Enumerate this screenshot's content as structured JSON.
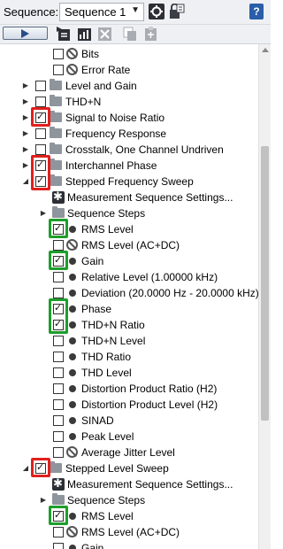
{
  "header": {
    "sequence_label": "Sequence:",
    "sequence_value": "Sequence 1"
  },
  "tree": [
    {
      "label": "Bits",
      "checked": false,
      "icon": "no-sign-icon"
    },
    {
      "label": "Error Rate",
      "checked": false,
      "icon": "no-sign-icon"
    },
    {
      "label": "Level and Gain",
      "checked": false,
      "icon": "folder-icon",
      "expanded": false
    },
    {
      "label": "THD+N",
      "checked": false,
      "icon": "folder-icon",
      "expanded": false
    },
    {
      "label": "Signal to Noise Ratio",
      "checked": true,
      "icon": "folder-icon",
      "expanded": false
    },
    {
      "label": "Frequency Response",
      "checked": false,
      "icon": "folder-icon",
      "expanded": false
    },
    {
      "label": "Crosstalk, One Channel Undriven",
      "checked": false,
      "icon": "folder-icon",
      "expanded": false
    },
    {
      "label": "Interchannel Phase",
      "checked": true,
      "icon": "folder-icon",
      "expanded": false
    },
    {
      "label": "Stepped Frequency Sweep",
      "checked": true,
      "icon": "folder-icon",
      "expanded": true
    },
    {
      "label": "Measurement Sequence Settings...",
      "icon": "gear-icon"
    },
    {
      "label": "Sequence Steps",
      "icon": "folder-icon",
      "expanded": false
    },
    {
      "label": "RMS Level",
      "checked": true,
      "icon": "dot-icon"
    },
    {
      "label": "RMS Level (AC+DC)",
      "checked": false,
      "icon": "no-sign-icon"
    },
    {
      "label": "Gain",
      "checked": true,
      "icon": "dot-icon"
    },
    {
      "label": "Relative Level (1.00000 kHz)",
      "checked": false,
      "icon": "dot-icon"
    },
    {
      "label": "Deviation (20.0000 Hz - 20.0000 kHz)",
      "checked": false,
      "icon": "dot-icon"
    },
    {
      "label": "Phase",
      "checked": true,
      "icon": "dot-icon"
    },
    {
      "label": "THD+N Ratio",
      "checked": true,
      "icon": "dot-icon"
    },
    {
      "label": "THD+N Level",
      "checked": false,
      "icon": "dot-icon"
    },
    {
      "label": "THD Ratio",
      "checked": false,
      "icon": "dot-icon"
    },
    {
      "label": "THD Level",
      "checked": false,
      "icon": "dot-icon"
    },
    {
      "label": "Distortion Product Ratio (H2)",
      "checked": false,
      "icon": "dot-icon"
    },
    {
      "label": "Distortion Product Level (H2)",
      "checked": false,
      "icon": "dot-icon"
    },
    {
      "label": "SINAD",
      "checked": false,
      "icon": "dot-icon"
    },
    {
      "label": "Peak Level",
      "checked": false,
      "icon": "dot-icon"
    },
    {
      "label": "Average Jitter Level",
      "checked": false,
      "icon": "no-sign-icon"
    },
    {
      "label": "Stepped Level Sweep",
      "checked": true,
      "icon": "folder-icon",
      "expanded": true
    },
    {
      "label": "Measurement Sequence Settings...",
      "icon": "gear-icon"
    },
    {
      "label": "Sequence Steps",
      "icon": "folder-icon",
      "expanded": false
    },
    {
      "label": "RMS Level",
      "checked": true,
      "icon": "dot-icon"
    },
    {
      "label": "RMS Level (AC+DC)",
      "checked": false,
      "icon": "no-sign-icon"
    },
    {
      "label": "Gain",
      "checked": false,
      "icon": "dot-icon"
    }
  ],
  "colors": {
    "highlight_red": "#e0201c",
    "highlight_green": "#1e9e2a"
  }
}
